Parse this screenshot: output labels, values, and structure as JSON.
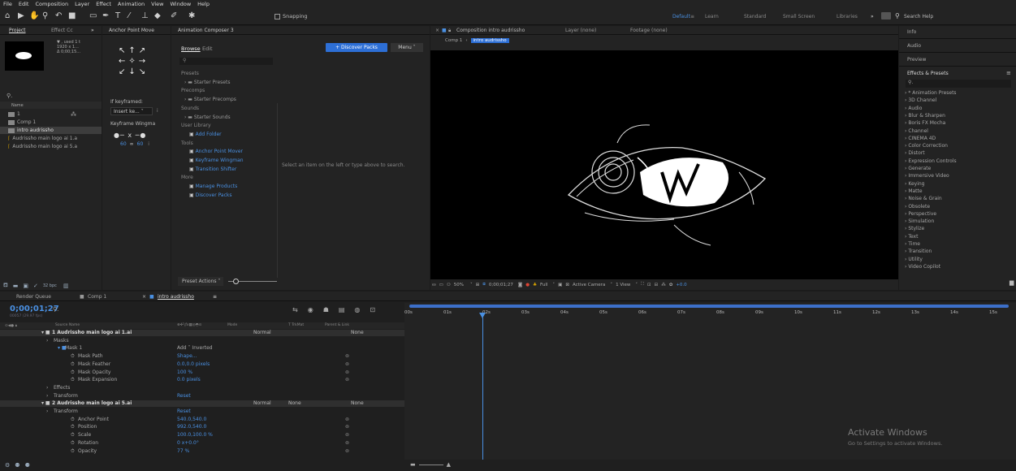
{
  "menu": [
    "File",
    "Edit",
    "Composition",
    "Layer",
    "Effect",
    "Animation",
    "View",
    "Window",
    "Help"
  ],
  "toolbar": {
    "snapping": "Snapping",
    "workspaces": [
      "Default",
      "≡",
      "Learn",
      "Standard",
      "Small Screen",
      "Libraries"
    ],
    "search_placeholder": "Search Help"
  },
  "project": {
    "tab": "Project",
    "tab2": "Effect Cc",
    "preview_info": [
      "▼ , used 1 t",
      "1920 x 1...",
      "Δ 0;00;15..."
    ],
    "name_header": "Name",
    "items": [
      "1",
      "Comp 1",
      "intro audrissho",
      "Audrissho main logo ai 1.a",
      "Audrissho main logo ai 5.a"
    ],
    "bpc": "32 bpc"
  },
  "anchor": {
    "tab": "Anchor Point Move",
    "if_keyframed": "If keyframed:",
    "insert": "Insert ke...",
    "wingman": "Keyframe Wingma",
    "v1": "60",
    "v2": "60"
  },
  "composer": {
    "tab": "Animation Composer 3",
    "browse": "Browse",
    "edit": "Edit",
    "discover": "+ Discover Packs",
    "menu": "Menu ˅",
    "tree": [
      {
        "t": "Presets",
        "h": 1
      },
      {
        "t": "Starter Presets",
        "f": 1
      },
      {
        "t": "Precomps",
        "h": 1
      },
      {
        "t": "Starter Precomps",
        "f": 1
      },
      {
        "t": "Sounds",
        "h": 1
      },
      {
        "t": "Starter Sounds",
        "f": 1
      },
      {
        "t": "User Library",
        "h": 1
      },
      {
        "t": "Add Folder",
        "b": 1
      },
      {
        "t": "Tools",
        "h": 1
      },
      {
        "t": "Anchor Point Mover",
        "b": 1
      },
      {
        "t": "Keyframe Wingman",
        "b": 1
      },
      {
        "t": "Transition Shifter",
        "b": 1
      },
      {
        "t": "More",
        "h": 1
      },
      {
        "t": "Manage Products",
        "b": 1
      },
      {
        "t": "Discover Packs",
        "b": 1
      }
    ],
    "hint": "Select an item on the left or type above to search.",
    "preset_actions": "Preset Actions ˅"
  },
  "comp": {
    "tab": "Composition intro audrissho",
    "layer_tab": "Layer (none)",
    "footage_tab": "Footage (none)",
    "crumb1": "Comp 1",
    "crumb2": "intro audrissho",
    "zoom": "50%",
    "timecode": "0;00;01;27",
    "res": "Full",
    "camera": "Active Camera",
    "view": "1 View",
    "exposure": "+0.0"
  },
  "effects": {
    "tabs": [
      "Info",
      "Audio",
      "Preview",
      "Effects & Presets"
    ],
    "list": [
      "* Animation Presets",
      "3D Channel",
      "Audio",
      "Blur & Sharpen",
      "Boris FX Mocha",
      "Channel",
      "CINEMA 4D",
      "Color Correction",
      "Distort",
      "Expression Controls",
      "Generate",
      "Immersive Video",
      "Keying",
      "Matte",
      "Noise & Grain",
      "Obsolete",
      "Perspective",
      "Simulation",
      "Stylize",
      "Text",
      "Time",
      "Transition",
      "Utility",
      "Video Copilot"
    ]
  },
  "timeline": {
    "tabs": [
      "Render Queue",
      "Comp 1",
      "intro audrissho"
    ],
    "timecode": "0;00;01;27",
    "frames": "00057 (29.97 fps)",
    "cols": [
      "Source Name",
      "Mode",
      "T TrkMat",
      "Parent & Link"
    ],
    "rows": [
      {
        "ind": 0,
        "t": "1   Audrissho main logo ai 1.ai",
        "layer": 1,
        "mode": "Normal",
        "parent": "None"
      },
      {
        "ind": 1,
        "t": "Masks"
      },
      {
        "ind": 2,
        "t": "Mask 1",
        "v": "Add   ˅    Inverted"
      },
      {
        "ind": 3,
        "t": "Mask Path",
        "v": "Shape...",
        "kf": [
          60,
          105
        ]
      },
      {
        "ind": 3,
        "t": "Mask Feather",
        "v": "0.0,0.0 pixels"
      },
      {
        "ind": 3,
        "t": "Mask Opacity",
        "v": "100 %"
      },
      {
        "ind": 3,
        "t": "Mask Expansion",
        "v": "0.0 pixels"
      },
      {
        "ind": 1,
        "t": "Effects",
        "kf": [
          160,
          180,
          200
        ]
      },
      {
        "ind": 1,
        "t": "Transform",
        "v": "Reset"
      },
      {
        "ind": 0,
        "t": "2   Audrissho main logo ai 5.ai",
        "layer": 1,
        "mode": "Normal",
        "trk": "None",
        "parent": "None"
      },
      {
        "ind": 1,
        "t": "Transform",
        "v": "Reset"
      },
      {
        "ind": 3,
        "t": "Anchor Point",
        "v": "540.0,540.0"
      },
      {
        "ind": 3,
        "t": "Position",
        "v": "992.0,540.0"
      },
      {
        "ind": 3,
        "t": "Scale",
        "v": "100.0,100.0 %"
      },
      {
        "ind": 3,
        "t": "Rotation",
        "v": "0 x+0.0°"
      },
      {
        "ind": 3,
        "t": "Opacity",
        "v": "77 %",
        "kf": [
          8,
          40,
          75,
          160
        ]
      }
    ],
    "ruler": [
      "00s",
      "01s",
      "02s",
      "03s",
      "04s",
      "05s",
      "06s",
      "07s",
      "08s",
      "09s",
      "10s",
      "11s",
      "12s",
      "13s",
      "14s",
      "15s"
    ]
  },
  "watermark": {
    "title": "Activate Windows",
    "sub": "Go to Settings to activate Windows."
  }
}
